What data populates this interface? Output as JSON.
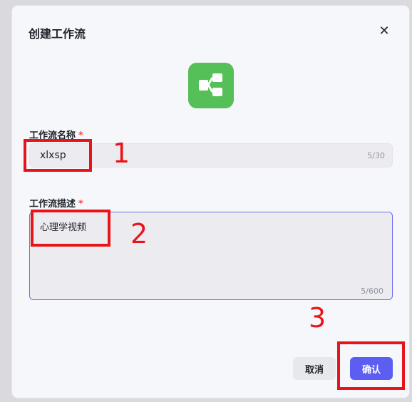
{
  "dialog": {
    "title": "创建工作流",
    "close_symbol": "✕"
  },
  "icons": {
    "app": "workflow-icon",
    "close": "close-icon"
  },
  "colors": {
    "app_icon_bg": "#55c057",
    "primary": "#5b5ef0",
    "required": "#f54a45",
    "annotation": "#e8141c"
  },
  "name_field": {
    "label": "工作流名称",
    "required_mark": "*",
    "value": "xlxsp",
    "count": "5/30"
  },
  "desc_field": {
    "label": "工作流描述",
    "required_mark": "*",
    "value": "心理学视频",
    "count": "5/600"
  },
  "buttons": {
    "cancel": "取消",
    "confirm": "确认"
  },
  "annotations": [
    "1",
    "2",
    "3"
  ]
}
